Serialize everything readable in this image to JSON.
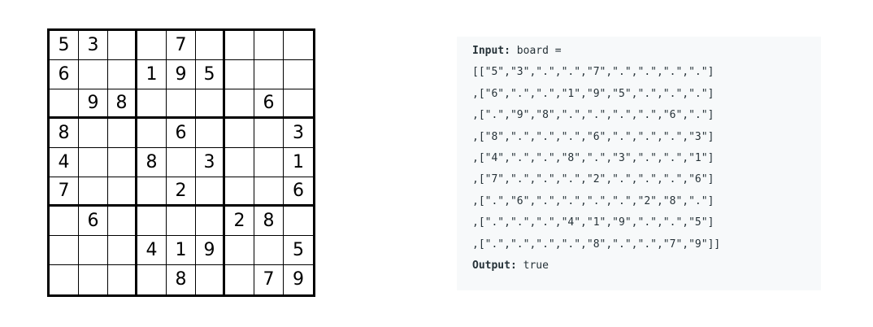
{
  "board": [
    [
      "5",
      "3",
      "",
      "",
      "7",
      "",
      "",
      "",
      ""
    ],
    [
      "6",
      "",
      "",
      "1",
      "9",
      "5",
      "",
      "",
      ""
    ],
    [
      "",
      "9",
      "8",
      "",
      "",
      "",
      "",
      "6",
      ""
    ],
    [
      "8",
      "",
      "",
      "",
      "6",
      "",
      "",
      "",
      "3"
    ],
    [
      "4",
      "",
      "",
      "8",
      "",
      "3",
      "",
      "",
      "1"
    ],
    [
      "7",
      "",
      "",
      "",
      "2",
      "",
      "",
      "",
      "6"
    ],
    [
      "",
      "6",
      "",
      "",
      "",
      "",
      "2",
      "8",
      ""
    ],
    [
      "",
      "",
      "",
      "4",
      "1",
      "9",
      "",
      "",
      "5"
    ],
    [
      "",
      "",
      "",
      "",
      "8",
      "",
      "",
      "7",
      "9"
    ]
  ],
  "example": {
    "input_label": "Input:",
    "input_text": " board =",
    "board_lines": [
      "[[\"5\",\"3\",\".\",\".\",\"7\",\".\",\".\",\".\",\".\"]",
      ",[\"6\",\".\",\".\",\"1\",\"9\",\"5\",\".\",\".\",\".\"]",
      ",[\".\",\"9\",\"8\",\".\",\".\",\".\",\".\",\"6\",\".\"]",
      ",[\"8\",\".\",\".\",\".\",\"6\",\".\",\".\",\".\",\"3\"]",
      ",[\"4\",\".\",\".\",\"8\",\".\",\"3\",\".\",\".\",\"1\"]",
      ",[\"7\",\".\",\".\",\".\",\"2\",\".\",\".\",\".\",\"6\"]",
      ",[\".\",\"6\",\".\",\".\",\".\",\".\",\"2\",\"8\",\".\"]",
      ",[\".\",\".\",\".\",\"4\",\"1\",\"9\",\".\",\".\",\"5\"]",
      ",[\".\",\".\",\".\",\".\",\"8\",\".\",\".\",\"7\",\"9\"]]"
    ],
    "output_label": "Output:",
    "output_text": " true"
  }
}
